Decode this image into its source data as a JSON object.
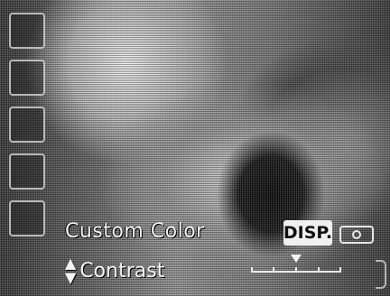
{
  "screen": {
    "caption": "Custom Color",
    "disp_label": "DISP.",
    "setting_label": "Contrast",
    "setting_value_fraction": 0.5,
    "icons": {
      "updown": "up-down-arrows-icon",
      "camera": "camera-icon",
      "left_icons": [
        "mode-icon-1",
        "mode-icon-2",
        "mode-icon-3",
        "mode-icon-4",
        "mode-icon-5"
      ]
    }
  }
}
